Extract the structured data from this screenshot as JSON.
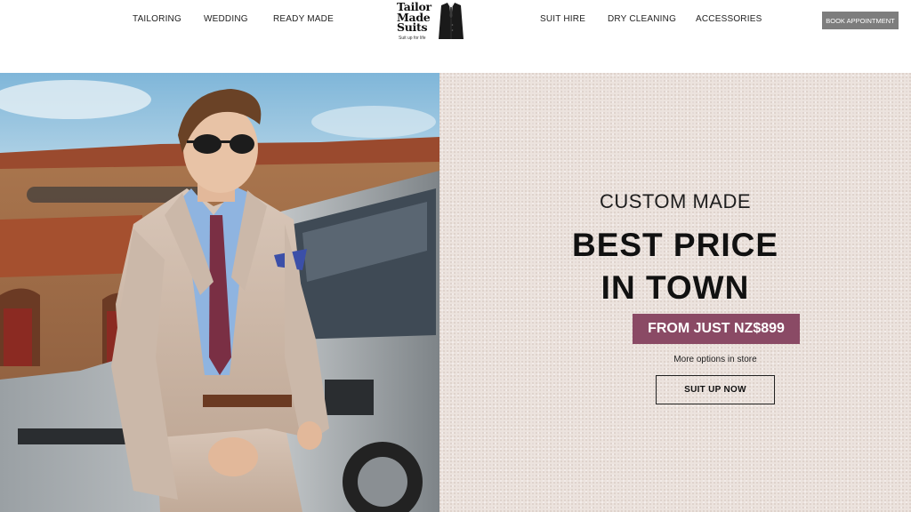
{
  "header": {
    "nav_left": [
      "TAILORING",
      "WEDDING",
      "READY MADE"
    ],
    "nav_right": [
      "SUIT HIRE",
      "DRY CLEANING",
      "ACCESSORIES"
    ],
    "logo": {
      "line1": "Tailor",
      "line2": "Made",
      "line3": "Suits",
      "tagline": "Suit up for life",
      "icon": "suit-jacket-icon"
    },
    "book_label": "BOOK APPOINTMENT"
  },
  "hero": {
    "image_alt": "Man in a beige suit leaning on a silver SUV",
    "kicker": "CUSTOM MADE",
    "headline_line1": "BEST PRICE",
    "headline_line2": "IN TOWN",
    "price_badge": "FROM JUST NZ$899",
    "sub_note": "More options in store",
    "cta_label": "SUIT UP NOW"
  },
  "colors": {
    "accent": "#8a4a65",
    "button_grey": "#7d7d7d",
    "panel_bg": "#ece3de"
  }
}
